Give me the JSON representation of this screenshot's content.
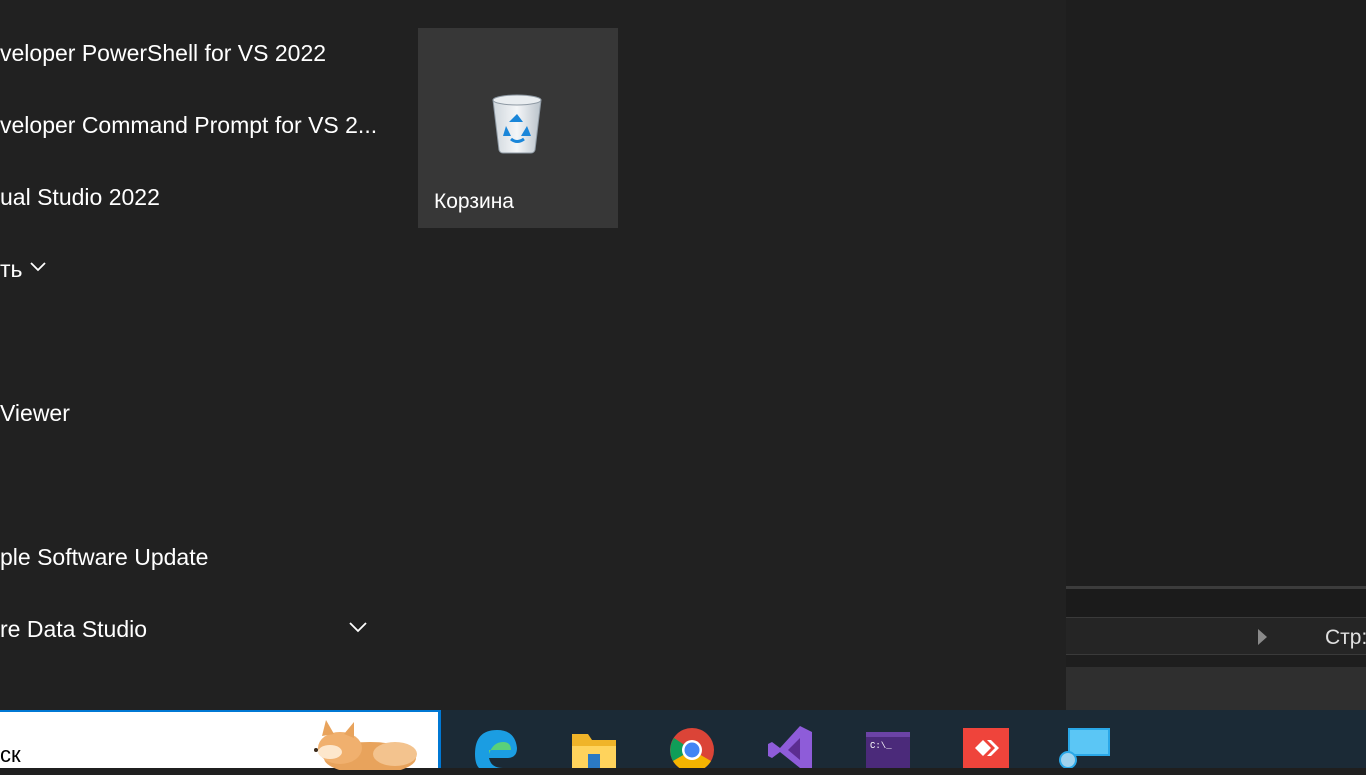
{
  "start_menu": {
    "apps": [
      {
        "label": "veloper PowerShell for VS 2022"
      },
      {
        "label": "veloper Command Prompt for VS 2..."
      },
      {
        "label": "ual Studio 2022"
      },
      {
        "label": "ть"
      },
      {
        "label": "Viewer"
      },
      {
        "label": "ple Software Update"
      },
      {
        "label": "re Data Studio"
      }
    ],
    "tiles": [
      {
        "label": "Корзина",
        "icon": "recycle-bin-icon"
      }
    ]
  },
  "background_app": {
    "page_label": "Стр:"
  },
  "taskbar": {
    "search_text": "ск",
    "accent": "#0078d4",
    "apps": [
      {
        "name": "Microsoft Edge",
        "icon": "edge-icon"
      },
      {
        "name": "File Explorer",
        "icon": "file-explorer-icon"
      },
      {
        "name": "Google Chrome",
        "icon": "chrome-icon"
      },
      {
        "name": "Visual Studio",
        "icon": "visual-studio-icon"
      },
      {
        "name": "Developer Command Prompt",
        "icon": "terminal-icon"
      },
      {
        "name": "AnyDesk",
        "icon": "anydesk-icon"
      },
      {
        "name": "Remote Desktop",
        "icon": "remote-desktop-icon"
      }
    ]
  }
}
